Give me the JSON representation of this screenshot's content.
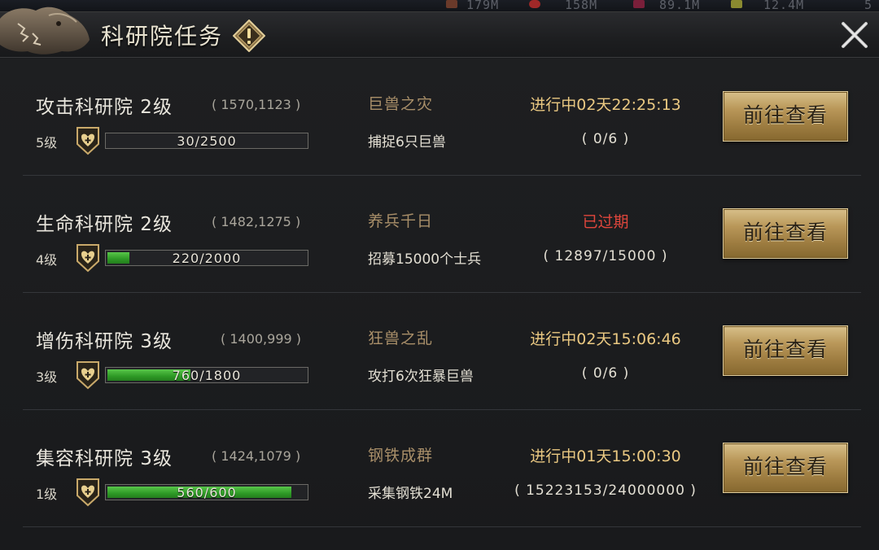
{
  "top_bar": {
    "resources": [
      "179M",
      "158M",
      "89.1M",
      "12.4M",
      "5"
    ]
  },
  "window": {
    "title": "科研院任务"
  },
  "institutes": [
    {
      "name": "攻击科研院 2级",
      "coords": "( 1570,1123 )",
      "level": "5级",
      "progress_text": "30/2500",
      "progress_fraction": 0.012,
      "task_name": "巨兽之灾",
      "task_desc": "捕捉6只巨兽",
      "status": "进行中02天22:25:13",
      "status_expired": false,
      "task_progress": "( 0/6 )",
      "button": "前往查看"
    },
    {
      "name": "生命科研院 2级",
      "coords": "( 1482,1275 )",
      "level": "4级",
      "progress_text": "220/2000",
      "progress_fraction": 0.11,
      "task_name": "养兵千日",
      "task_desc": "招募15000个士兵",
      "status": "已过期",
      "status_expired": true,
      "task_progress": "( 12897/15000 )",
      "button": "前往查看"
    },
    {
      "name": "增伤科研院 3级",
      "coords": "( 1400,999 )",
      "level": "3级",
      "progress_text": "760/1800",
      "progress_fraction": 0.422,
      "task_name": "狂兽之乱",
      "task_desc": "攻打6次狂暴巨兽",
      "status": "进行中02天15:06:46",
      "status_expired": false,
      "task_progress": "( 0/6 )",
      "button": "前往查看"
    },
    {
      "name": "集容科研院 3级",
      "coords": "( 1424,1079 )",
      "level": "1级",
      "progress_text": "560/600",
      "progress_fraction": 0.933,
      "task_name": "钢铁成群",
      "task_desc": "采集钢铁24M",
      "status": "进行中01天15:00:30",
      "status_expired": false,
      "task_progress": "( 15223153/24000000 )",
      "button": "前往查看"
    }
  ],
  "colors": {
    "status_active": "#ebc982",
    "status_expired": "#e0463c",
    "task_name": "#a98f69",
    "progress_fill": "#3aa830"
  },
  "icons": {
    "info": "info-diamond-icon",
    "close": "close-icon",
    "level": "heart-shield-icon"
  }
}
